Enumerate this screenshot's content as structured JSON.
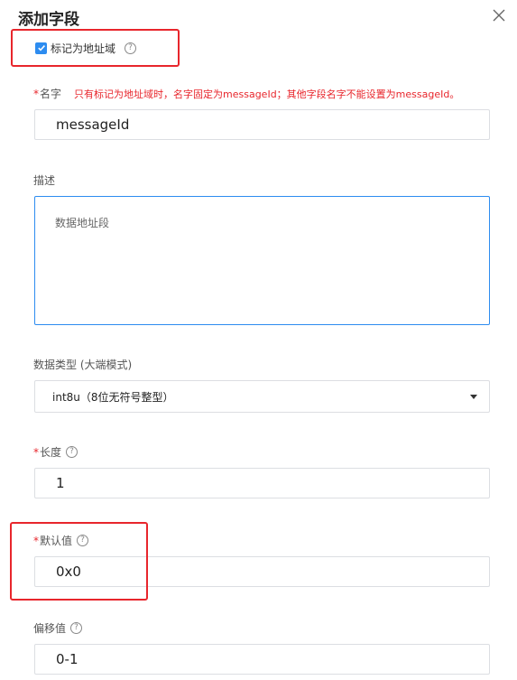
{
  "dialog": {
    "title": "添加字段"
  },
  "address_field": {
    "checked": true,
    "label": "标记为地址域",
    "help_icon": "question-circle-icon"
  },
  "name": {
    "required_mark": "*",
    "label": "名字",
    "note": "只有标记为地址域时，名字固定为messageId；其他字段名字不能设置为messageId。",
    "value": "messageId"
  },
  "description": {
    "label": "描述",
    "value": "数据地址段"
  },
  "data_type": {
    "label": "数据类型 (大端模式)",
    "selected": "int8u（8位无符号整型）"
  },
  "length": {
    "required_mark": "*",
    "label": "长度",
    "value": "1"
  },
  "default_value": {
    "required_mark": "*",
    "label": "默认值",
    "value": "0x0"
  },
  "offset": {
    "label": "偏移值",
    "value": "0-1"
  },
  "colors": {
    "accent": "#2d8cf0",
    "annotation_red": "#e8262c",
    "required_red": "#e8262c"
  }
}
